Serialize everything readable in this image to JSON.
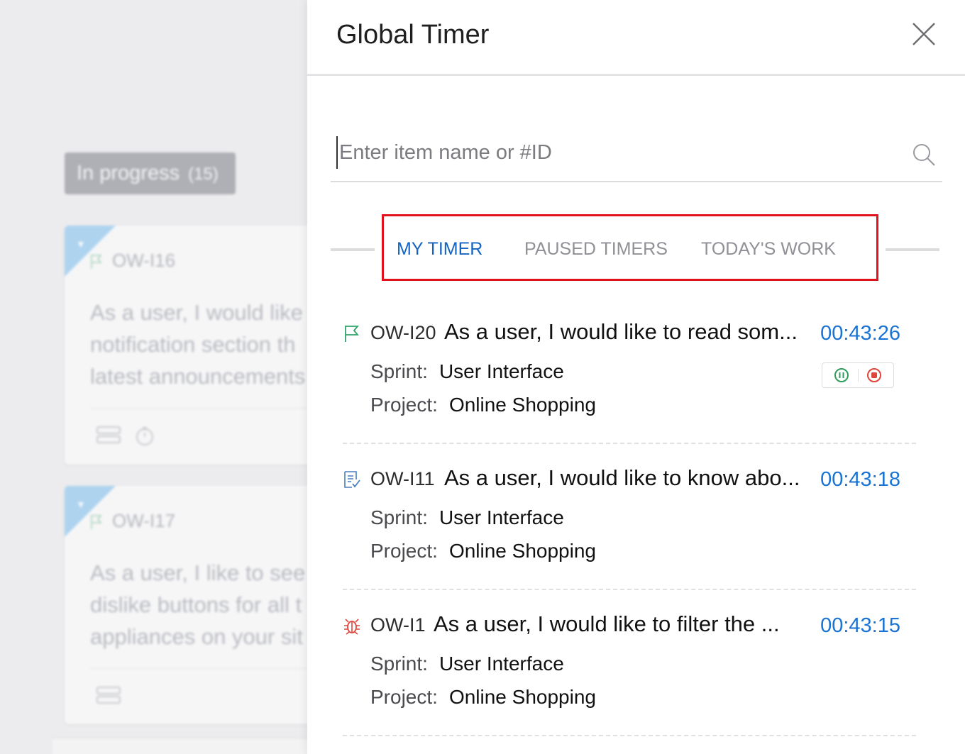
{
  "background": {
    "column": {
      "label": "In progress",
      "count": "(15)"
    },
    "cards": [
      {
        "id": "OW-I16",
        "text": "As a user, I would like t\nnotification section th\nlatest announcements"
      },
      {
        "id": "OW-I17",
        "text": "As a user, I like to see l\ndislike buttons for all t\nappliances on your sit"
      }
    ]
  },
  "panel": {
    "title": "Global Timer",
    "search": {
      "placeholder": "Enter item name or #ID",
      "value": ""
    },
    "tabs": [
      {
        "label": "MY TIMER",
        "active": true
      },
      {
        "label": "PAUSED TIMERS",
        "active": false
      },
      {
        "label": "TODAY'S WORK",
        "active": false
      }
    ],
    "entries": [
      {
        "icon": "flag-icon",
        "id": "OW-I20",
        "title": "As a user, I would like to read som...",
        "time": "00:43:26",
        "sprint_label": "Sprint:",
        "sprint": "User Interface",
        "project_label": "Project:",
        "project": "Online Shopping"
      },
      {
        "icon": "story-icon",
        "id": "OW-I11",
        "title": "As a user, I would like to know abo...",
        "time": "00:43:18",
        "sprint_label": "Sprint:",
        "sprint": "User Interface",
        "project_label": "Project:",
        "project": "Online Shopping"
      },
      {
        "icon": "bug-icon",
        "id": "OW-I1",
        "title": "As a user, I would like to filter the ...",
        "time": "00:43:15",
        "sprint_label": "Sprint:",
        "sprint": "User Interface",
        "project_label": "Project:",
        "project": "Online Shopping"
      }
    ]
  },
  "colors": {
    "accent": "#1565c0",
    "timer": "#1a73d3",
    "highlight_box": "#e1121b",
    "pause": "#2e9d5b",
    "stop": "#e0443a"
  }
}
